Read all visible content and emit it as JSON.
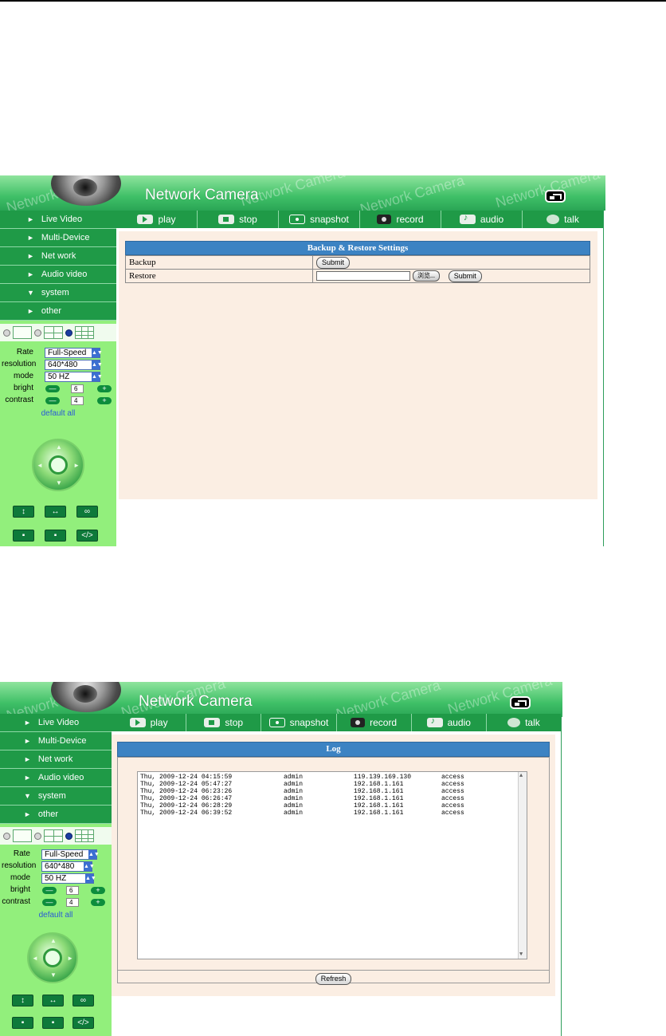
{
  "app": {
    "title": "Network Camera",
    "watermark": "Network Camera"
  },
  "toolbar": {
    "items": [
      {
        "label": "play",
        "icon": "play-icon"
      },
      {
        "label": "stop",
        "icon": "stop-icon"
      },
      {
        "label": "snapshot",
        "icon": "snapshot-icon"
      },
      {
        "label": "record",
        "icon": "record-icon"
      },
      {
        "label": "audio",
        "icon": "audio-icon"
      },
      {
        "label": "talk",
        "icon": "talk-icon"
      }
    ]
  },
  "sidebar": {
    "menu": [
      {
        "label": "Live Video",
        "expanded": false
      },
      {
        "label": "Multi-Device",
        "expanded": false
      },
      {
        "label": "Net work",
        "expanded": false
      },
      {
        "label": "Audio video",
        "expanded": false
      },
      {
        "label": "system",
        "expanded": true
      },
      {
        "label": "other",
        "expanded": false
      }
    ],
    "controls": {
      "rate_label": "Rate",
      "rate_value": "Full-Speed",
      "resolution_label": "resolution",
      "resolution_value": "640*480",
      "mode_label": "mode",
      "mode_value": "50 HZ",
      "bright_label": "bright",
      "bright_value": "6",
      "contrast_label": "contrast",
      "contrast_value": "4",
      "minus": "—",
      "plus": "+",
      "default_all": "default all"
    },
    "bottom_buttons": {
      "row1": [
        "↕",
        "↔",
        "∞"
      ],
      "row2": [
        "▪",
        "▪",
        "</>"
      ]
    }
  },
  "backup_page": {
    "header": "Backup & Restore Settings",
    "backup_label": "Backup",
    "restore_label": "Restore",
    "submit": "Submit",
    "browse": "浏览..."
  },
  "log_page": {
    "header": "Log",
    "refresh": "Refresh",
    "entries": [
      {
        "time": "Thu, 2009-12-24 04:15:59",
        "user": "admin",
        "ip": "119.139.169.130",
        "action": "access"
      },
      {
        "time": "Thu, 2009-12-24 05:47:27",
        "user": "admin",
        "ip": "192.168.1.161",
        "action": "access"
      },
      {
        "time": "Thu, 2009-12-24 06:23:26",
        "user": "admin",
        "ip": "192.168.1.161",
        "action": "access"
      },
      {
        "time": "Thu, 2009-12-24 06:26:47",
        "user": "admin",
        "ip": "192.168.1.161",
        "action": "access"
      },
      {
        "time": "Thu, 2009-12-24 06:28:29",
        "user": "admin",
        "ip": "192.168.1.161",
        "action": "access"
      },
      {
        "time": "Thu, 2009-12-24 06:39:52",
        "user": "admin",
        "ip": "192.168.1.161",
        "action": "access"
      }
    ]
  },
  "colors": {
    "nav_green": "#1f9a47",
    "sidebar_green": "#92ef7c",
    "header_blue": "#3c83c3",
    "content_bg": "#fbeee3"
  }
}
